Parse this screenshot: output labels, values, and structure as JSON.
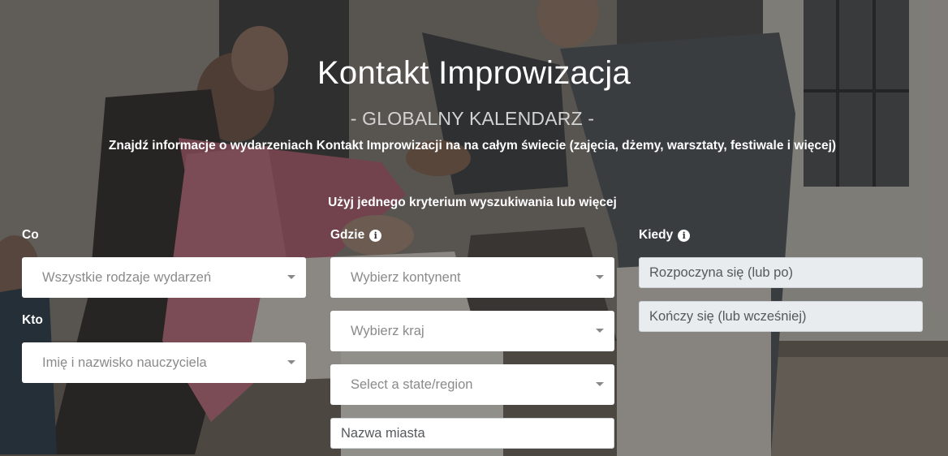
{
  "header": {
    "title": "Kontakt Improwizacja",
    "subtitle": "- GLOBALNY KALENDARZ -",
    "tagline": "Znajdź informacje o wydarzeniach Kontakt Improwizacji na na całym świecie (zajęcia, dżemy, warsztaty, festiwale i więcej)",
    "search_hint": "Użyj jednego kryterium wyszukiwania lub więcej"
  },
  "filters": {
    "what": {
      "label": "Co",
      "event_type_placeholder": "Wszystkie rodzaje wydarzeń"
    },
    "who": {
      "label": "Kto",
      "teacher_placeholder": "Imię i nazwisko nauczyciela"
    },
    "where": {
      "label": "Gdzie",
      "continent_placeholder": "Wybierz kontynent",
      "country_placeholder": "Wybierz kraj",
      "state_placeholder": "Select a state/region",
      "city_placeholder": "Nazwa miasta"
    },
    "when": {
      "label": "Kiedy",
      "start_placeholder": "Rozpoczyna się (lub po)",
      "end_placeholder": "Kończy się (lub wcześniej)"
    }
  },
  "icons": {
    "info": "info-circle-icon",
    "dropdown": "caret-down-icon"
  },
  "colors": {
    "field_bg": "#ffffff",
    "date_field_bg": "#e9ecef",
    "subtitle": "#d3d3d3"
  }
}
